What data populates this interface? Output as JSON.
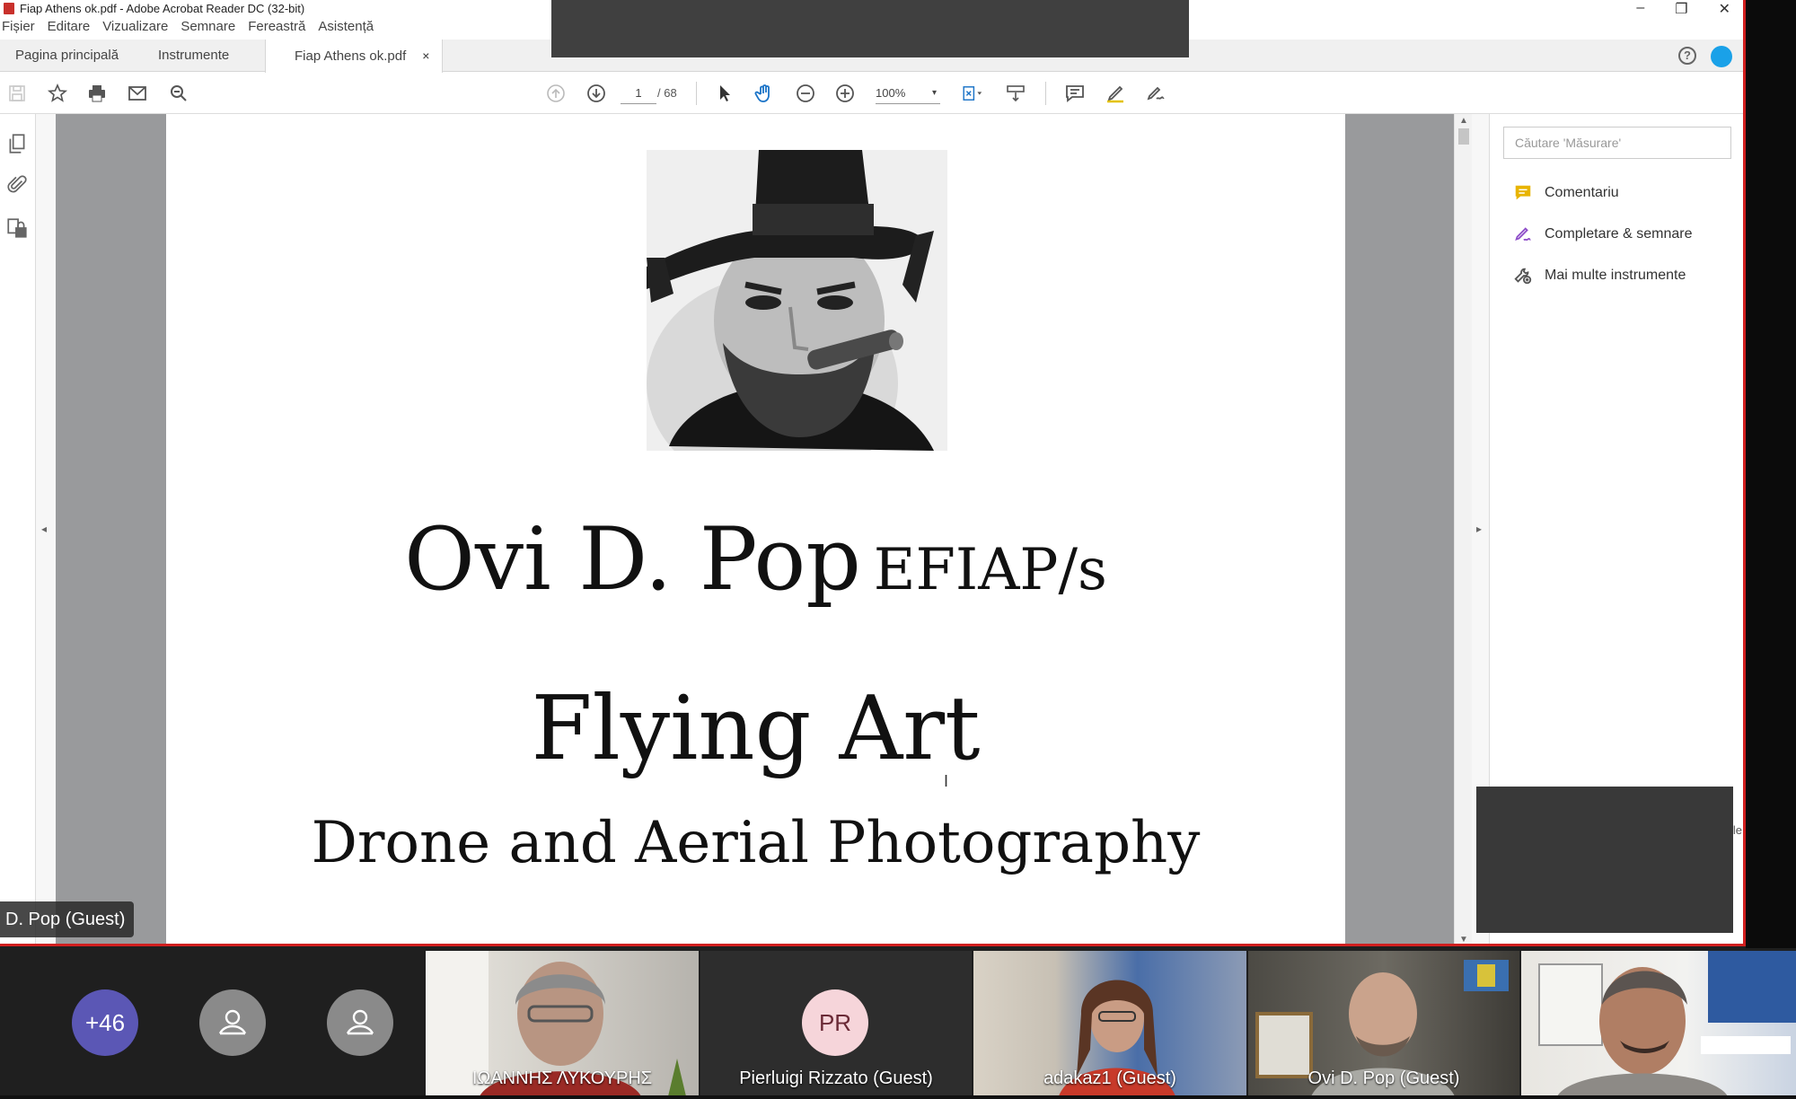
{
  "window": {
    "title": "Fiap Athens ok.pdf - Adobe Acrobat Reader DC (32-bit)",
    "min": "–",
    "restore": "❐",
    "close": "✕"
  },
  "menu": [
    "Fișier",
    "Editare",
    "Vizualizare",
    "Semnare",
    "Fereastră",
    "Asistență"
  ],
  "tabs": {
    "home": "Pagina principală",
    "tools": "Instrumente",
    "doc": "Fiap Athens ok.pdf",
    "doc_close": "×"
  },
  "help": "?",
  "toolbar": {
    "page_current": "1",
    "page_total": "/  68",
    "zoom": "100%",
    "zoom_caret": "▾"
  },
  "document": {
    "name": "Ovi D. Pop",
    "distinction": "EFIAP/s",
    "title": "Flying Art",
    "subtitle": "Drone and Aerial Photography",
    "cursor": "I"
  },
  "tools_pane": {
    "search_placeholder": "Căutare 'Măsurare'",
    "items": [
      {
        "label": "Comentariu",
        "icon": "comment-icon",
        "color": "#e8b400"
      },
      {
        "label": "Completare & semnare",
        "icon": "fill-sign-icon",
        "color": "#8f4fc9"
      },
      {
        "label": "Mai multe instrumente",
        "icon": "more-tools-icon",
        "color": "#555555"
      }
    ],
    "edge_text": "le"
  },
  "collapse": {
    "left": "◂",
    "right": "▸",
    "up": "▲",
    "down": "▼"
  },
  "speaker_label": "D. Pop (Guest)",
  "participants": {
    "more": "+46",
    "tiles": [
      {
        "name": "ΙΩΑΝΝΗΣ ΛΥΚΟΥΡΗΣ"
      },
      {
        "name": "Pierluigi Rizzato (Guest)",
        "initials": "PR"
      },
      {
        "name": "adakaz1 (Guest)"
      },
      {
        "name": "Ovi D. Pop (Guest)"
      }
    ]
  },
  "colors": {
    "share_border": "#d11f1f",
    "accent": "#1aa1e8",
    "more_badge": "#5b57b5"
  }
}
